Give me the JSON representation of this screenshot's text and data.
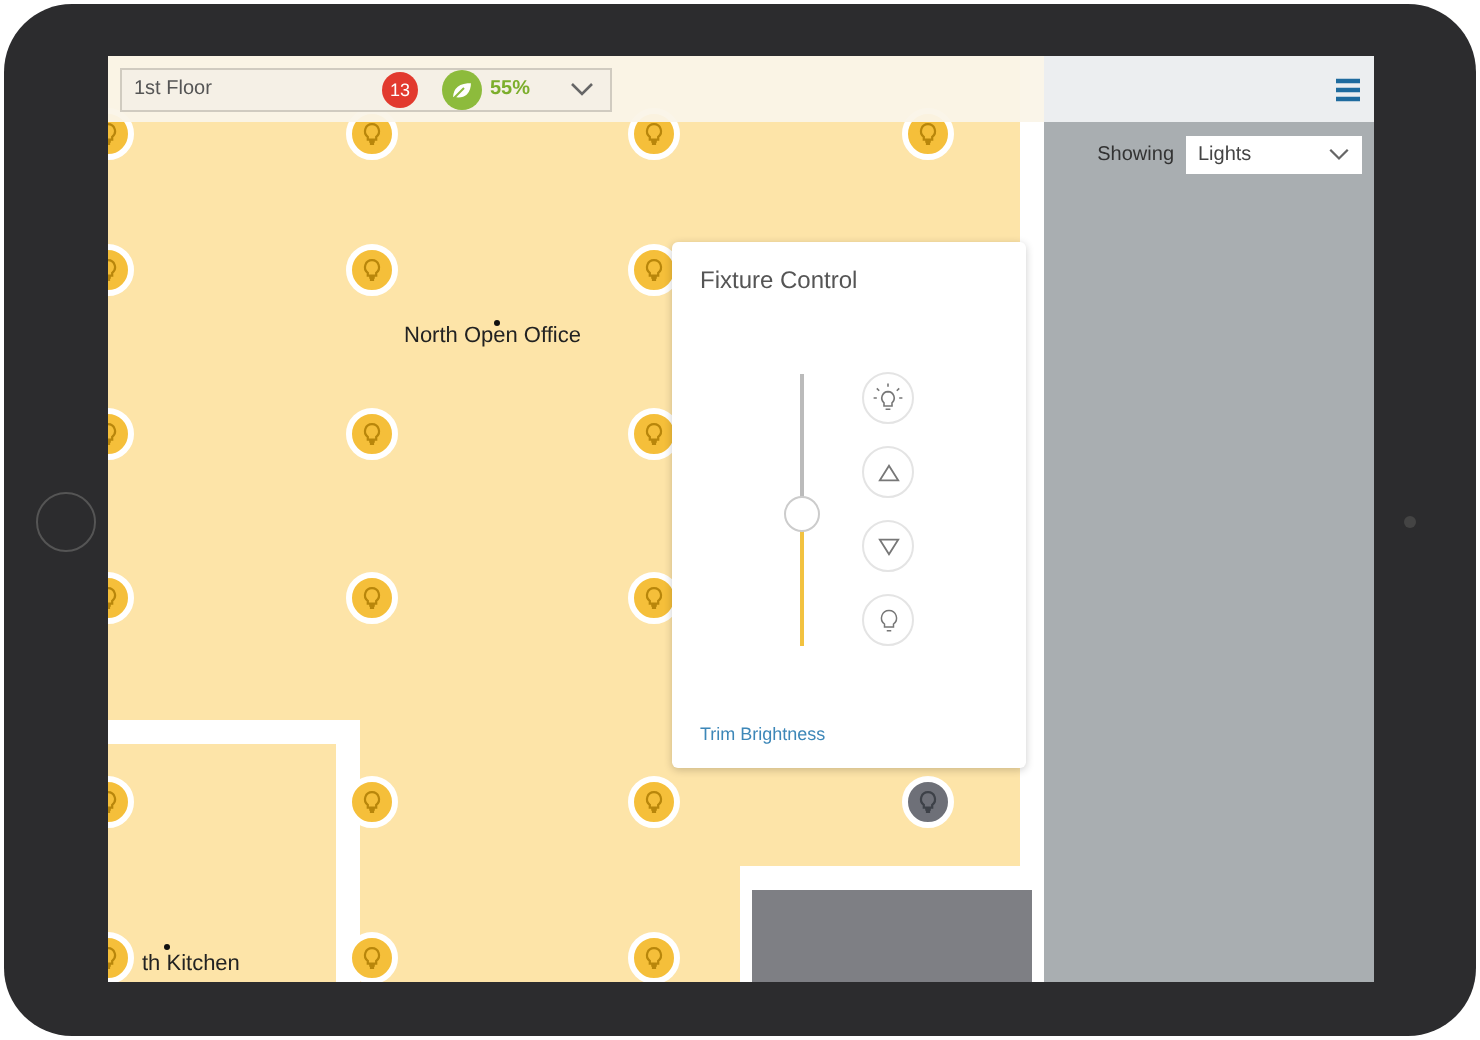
{
  "floor_selector": {
    "value": "1st Floor",
    "alert_count": "13",
    "energy_savings": "55%"
  },
  "map": {
    "rooms": [
      {
        "label": "North Open Office"
      },
      {
        "label": "th Kitchen"
      }
    ],
    "light_rows": [
      {
        "lights": [
          {
            "on": true
          },
          {
            "on": true
          },
          {
            "on": true
          },
          {
            "on": true
          }
        ]
      },
      {
        "lights": [
          {
            "on": true
          },
          {
            "on": true
          },
          {
            "on": true
          }
        ]
      },
      {
        "lights": [
          {
            "on": true
          },
          {
            "on": true
          },
          {
            "on": true
          }
        ]
      },
      {
        "lights": [
          {
            "on": true
          },
          {
            "on": true
          },
          {
            "on": true
          }
        ]
      },
      {
        "lights": [
          {
            "on": true
          },
          {
            "on": true
          },
          {
            "on": true
          },
          {
            "on": false
          }
        ]
      },
      {
        "lights": [
          {
            "on": true
          },
          {
            "on": true
          },
          {
            "on": true
          }
        ]
      }
    ]
  },
  "filter": {
    "label": "Showing",
    "value": "Lights"
  },
  "fixture_control": {
    "title": "Fixture Control",
    "brightness": {
      "level": 0.48
    },
    "buttons": [
      {
        "kind": "full_on"
      },
      {
        "kind": "up"
      },
      {
        "kind": "down"
      },
      {
        "kind": "off"
      }
    ],
    "link": "Trim Brightness"
  }
}
